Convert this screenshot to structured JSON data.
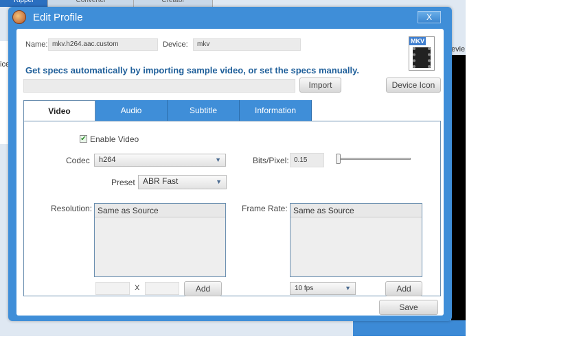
{
  "background": {
    "tabs": [
      "Ripper",
      "Converter",
      "Creator"
    ],
    "side_text": "ice",
    "preview_text": "evie"
  },
  "dialog": {
    "title": "Edit Profile",
    "close_label": "X",
    "name_label": "Name:",
    "name_value": "mkv.h264.aac.custom",
    "device_label": "Device:",
    "device_value": "mkv",
    "device_icon_text": "MKV",
    "hint": "Get specs automatically by importing sample video, or set the specs manually.",
    "import_path": "",
    "import_label": "Import",
    "device_icon_label": "Device Icon",
    "tabs": [
      "Video",
      "Audio",
      "Subtitle",
      "Information"
    ],
    "video": {
      "enable_label": "Enable Video",
      "enabled": true,
      "codec_label": "Codec",
      "codec_value": "h264",
      "bits_label": "Bits/Pixel:",
      "bits_value": "0.15",
      "bits_slider": 0.0,
      "preset_label": "Preset",
      "preset_value": "ABR Fast",
      "resolution_label": "Resolution:",
      "resolution_items": [
        "Same as Source"
      ],
      "width_value": "",
      "x_label": "X",
      "height_value": "",
      "add_res_label": "Add",
      "framerate_label": "Frame Rate:",
      "framerate_items": [
        "Same as Source"
      ],
      "fps_value": "10 fps",
      "add_fps_label": "Add"
    },
    "save_label": "Save"
  }
}
